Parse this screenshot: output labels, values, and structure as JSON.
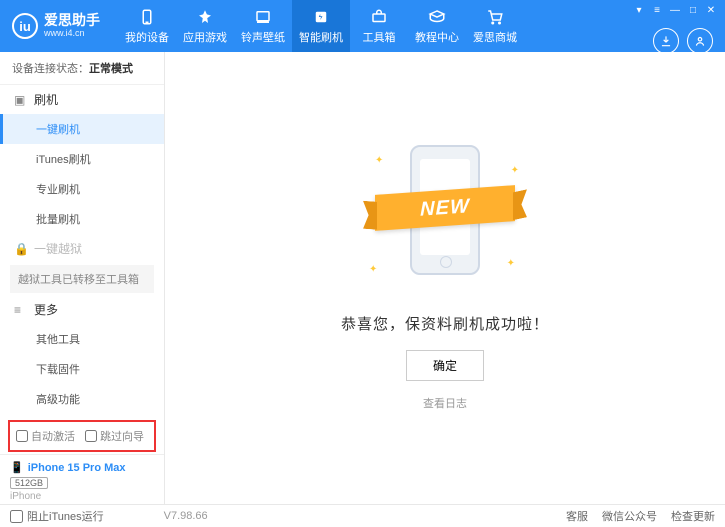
{
  "app": {
    "name": "爱思助手",
    "url": "www.i4.cn"
  },
  "nav": [
    {
      "label": "我的设备",
      "icon": "device"
    },
    {
      "label": "应用游戏",
      "icon": "apps"
    },
    {
      "label": "铃声壁纸",
      "icon": "media"
    },
    {
      "label": "智能刷机",
      "icon": "flash"
    },
    {
      "label": "工具箱",
      "icon": "tools"
    },
    {
      "label": "教程中心",
      "icon": "tutorial"
    },
    {
      "label": "爱思商城",
      "icon": "shop"
    }
  ],
  "nav_active_index": 3,
  "sidebar": {
    "status_label": "设备连接状态：",
    "status_value": "正常模式",
    "flash_group": "刷机",
    "flash_items": [
      "一键刷机",
      "iTunes刷机",
      "专业刷机",
      "批量刷机"
    ],
    "flash_active": 0,
    "jailbreak_group": "一键越狱",
    "jailbreak_note": "越狱工具已转移至工具箱",
    "more_group": "更多",
    "more_items": [
      "其他工具",
      "下载固件",
      "高级功能"
    ],
    "cb_auto_activate": "自动激活",
    "cb_skip_guide": "跳过向导"
  },
  "device": {
    "name": "iPhone 15 Pro Max",
    "storage": "512GB",
    "type": "iPhone"
  },
  "main": {
    "banner": "NEW",
    "success": "恭喜您，保资料刷机成功啦！",
    "ok": "确定",
    "view_log": "查看日志"
  },
  "footer": {
    "block_itunes": "阻止iTunes运行",
    "version": "V7.98.66",
    "links": [
      "客服",
      "微信公众号",
      "检查更新"
    ]
  }
}
